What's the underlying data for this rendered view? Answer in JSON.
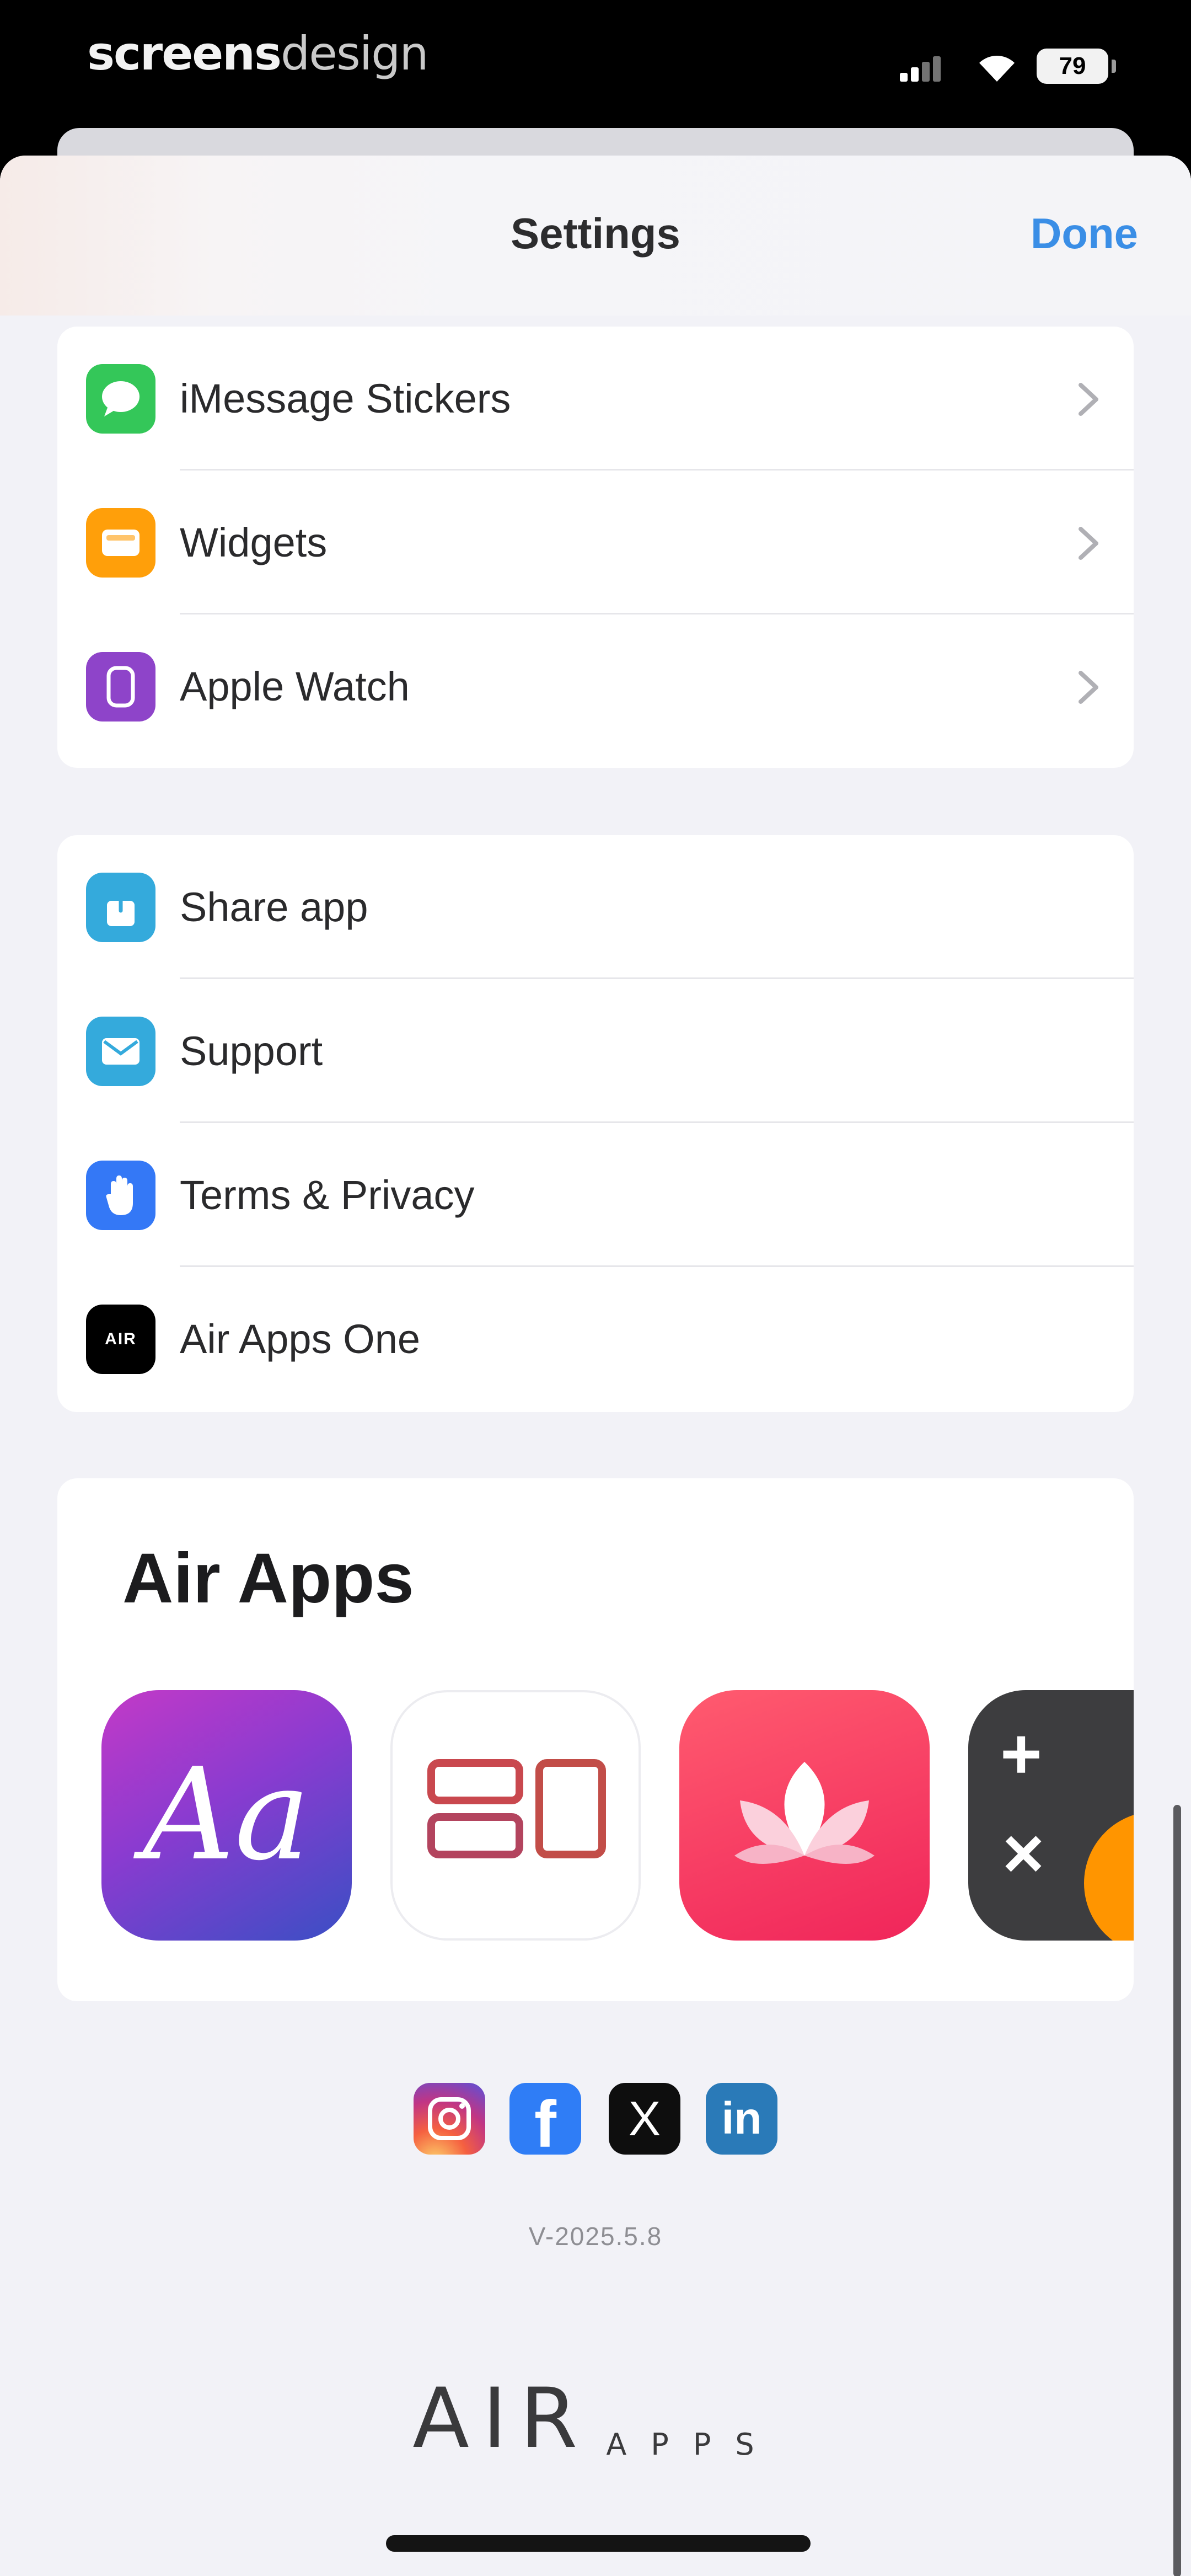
{
  "status_bar": {
    "watermark_bold": "screens",
    "watermark_light": "design",
    "battery": "79"
  },
  "nav": {
    "title": "Settings",
    "done_label": "Done"
  },
  "group1": [
    {
      "label": "iMessage Stickers",
      "icon": "message-icon",
      "color": "#34c759"
    },
    {
      "label": "Widgets",
      "icon": "widget-icon",
      "color": "#ff9f0a"
    },
    {
      "label": "Apple Watch",
      "icon": "watch-icon",
      "color": "#8e44c9"
    }
  ],
  "group2": [
    {
      "label": "Share app",
      "icon": "share-icon",
      "color": "#34aadc"
    },
    {
      "label": "Support",
      "icon": "mail-icon",
      "color": "#34aadc"
    },
    {
      "label": "Terms & Privacy",
      "icon": "hand-icon",
      "color": "#3478f6"
    },
    {
      "label": "Air Apps One",
      "icon": "air-apps-one-icon",
      "color": "#000000",
      "icon_text": "AIR"
    }
  ],
  "apps_card": {
    "heading": "Air Apps",
    "apps": [
      {
        "name": "fonts-app-icon",
        "glyph": "Aa"
      },
      {
        "name": "widgets-app-icon"
      },
      {
        "name": "lotus-app-icon"
      },
      {
        "name": "calculator-app-icon",
        "glyph_plus": "+",
        "glyph_times": "×"
      }
    ]
  },
  "social": [
    {
      "name": "instagram-icon"
    },
    {
      "name": "facebook-icon",
      "glyph": "f"
    },
    {
      "name": "x-icon",
      "glyph": "X"
    },
    {
      "name": "linkedin-icon",
      "glyph": "in"
    }
  ],
  "footer": {
    "version": "V-2025.5.8",
    "logo_big": "AIR",
    "logo_small": "APPS"
  }
}
